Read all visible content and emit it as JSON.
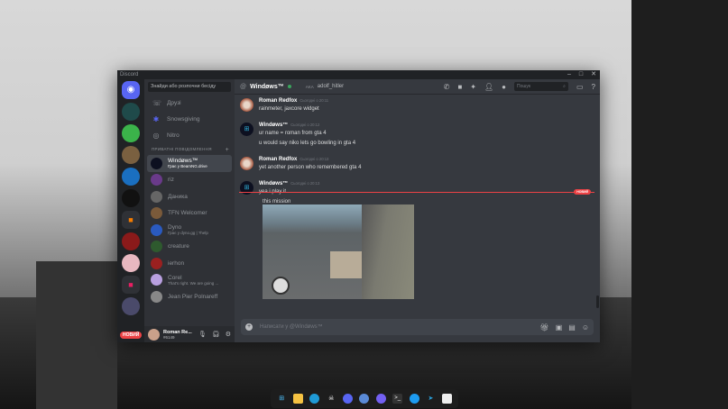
{
  "app": {
    "title": "Discord",
    "window_controls": [
      "–",
      "□",
      "✕"
    ]
  },
  "servers": {
    "new_badge": "НОВИЙ"
  },
  "channels": {
    "search_placeholder": "Знайди або розпочни бесіду",
    "nav": [
      {
        "label": "Друзі",
        "icon": "friends-icon"
      },
      {
        "label": "Snowsgiving",
        "icon": "snowflake-icon"
      },
      {
        "label": "Nitro",
        "icon": "nitro-icon"
      }
    ],
    "dm_header": "ПРИВАТНІ ПОВІДОМЛЕННЯ",
    "dm_add": "+",
    "dms": [
      {
        "name": "Windøws™",
        "sub": "Грає у BeamNG.drive",
        "active": true,
        "color": "#0d1020"
      },
      {
        "name": "riz",
        "sub": "",
        "color": "#6a3a8a"
      },
      {
        "name": "Даника",
        "sub": "",
        "color": "#666"
      },
      {
        "name": "TFN Welcomer",
        "sub": "",
        "color": "#7a5a3a"
      },
      {
        "name": "Dyno",
        "sub": "Грає у dyno.gg | ?help",
        "color": "#2a5ac0"
      },
      {
        "name": "creature",
        "sub": "",
        "color": "#2e5a2e"
      },
      {
        "name": "ierhon",
        "sub": "",
        "color": "#9a2020"
      },
      {
        "name": "Corel",
        "sub": "That's right. We are going ...",
        "color": "#b9a0e0"
      },
      {
        "name": "Jean Pier Polnareff",
        "sub": "",
        "color": "#888"
      }
    ]
  },
  "user": {
    "name": "Roman Re...",
    "tag": "#6149"
  },
  "chat": {
    "recipient": "Windøws™",
    "aka_label": "AKA",
    "aka_name": "adolf_hitler",
    "search_placeholder": "Пошук",
    "messages": [
      {
        "author": "Roman Redfox",
        "time": "Сьогодні о 20:11",
        "lines": [
          "rainmeter, jaxcore widget"
        ]
      },
      {
        "author": "Windøws™",
        "time": "Сьогодні о 20:12",
        "lines": [
          "ur name = roman from gta 4",
          "u would say niko lets go bowling in gta 4"
        ]
      },
      {
        "author": "Roman Redfox",
        "time": "Сьогодні о 20:13",
        "lines": [
          "yet another person who remembered gta 4"
        ]
      },
      {
        "author": "Windøws™",
        "time": "Сьогодні о 20:13",
        "lines": [
          "yea i play it"
        ]
      }
    ],
    "new_divider": "НОВИЙ",
    "continuation": "this mission",
    "input_placeholder": "Написати у @Windøws™"
  }
}
